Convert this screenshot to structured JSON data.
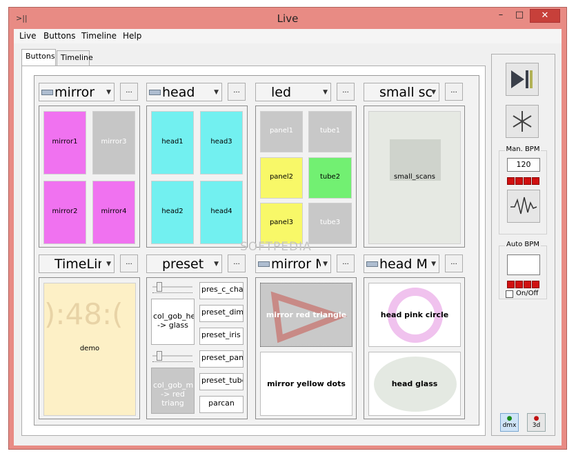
{
  "window": {
    "title": "Live",
    "app_icon": ">||",
    "minimize_glyph": "–",
    "maximize_glyph": "□",
    "close_glyph": "✕"
  },
  "menu": [
    "Live",
    "Buttons",
    "Timeline",
    "Help"
  ],
  "tabs": [
    "Buttons",
    "Timeline"
  ],
  "groups": [
    {
      "title": "mirror",
      "has_indicator": true,
      "more": "...",
      "cells": [
        {
          "label": "mirror1",
          "color": "#f072f0",
          "dim": false
        },
        {
          "label": "mirror3",
          "color": "#c6c6c6",
          "dim": true
        },
        {
          "label": "mirror2",
          "color": "#f072f0",
          "dim": false
        },
        {
          "label": "mirror4",
          "color": "#f072f0",
          "dim": false
        }
      ]
    },
    {
      "title": "head",
      "has_indicator": true,
      "more": "...",
      "cells": [
        {
          "label": "head1",
          "color": "#72f0f0",
          "dim": false
        },
        {
          "label": "head3",
          "color": "#72f0f0",
          "dim": false
        },
        {
          "label": "head2",
          "color": "#72f0f0",
          "dim": false
        },
        {
          "label": "head4",
          "color": "#72f0f0",
          "dim": false
        }
      ]
    },
    {
      "title": "led",
      "has_indicator": false,
      "more": "...",
      "cells": [
        {
          "label": "panel1",
          "color": "#c8c8c8",
          "dim": true
        },
        {
          "label": "tube1",
          "color": "#c8c8c8",
          "dim": true
        },
        {
          "label": "panel2",
          "color": "#f8f868",
          "dim": false
        },
        {
          "label": "tube2",
          "color": "#72f072",
          "dim": false
        },
        {
          "label": "panel3",
          "color": "#f8f868",
          "dim": false
        },
        {
          "label": "tube3",
          "color": "#c8c8c8",
          "dim": true
        }
      ]
    },
    {
      "title": "small sc",
      "has_indicator": false,
      "more": "...",
      "cells": [
        {
          "label": "small_scans",
          "color": "#e6e9e3",
          "dim": false
        }
      ]
    },
    {
      "title": "TimeLin",
      "has_indicator": false,
      "more": "...",
      "cells": [
        {
          "label": "demo",
          "color": "#fdf0c6",
          "dim": false
        }
      ],
      "digits": "):48:("
    },
    {
      "title": "preset",
      "has_indicator": false,
      "more": "...",
      "left_buttons": [
        "col_gob_hea -> glass",
        "col_gob_mirr -> red triang"
      ],
      "right_buttons": [
        "pres_c_cha",
        "preset_dimm",
        "preset_iris",
        "preset_pane",
        "preset_tube",
        "parcan"
      ]
    },
    {
      "title": "mirror M",
      "has_indicator": true,
      "more": "...",
      "cells": [
        {
          "label": "mirror red triangle",
          "color": "#c9c9c9",
          "dim": true
        },
        {
          "label": "mirror yellow dots",
          "color": "#ffffff",
          "dim": false
        }
      ]
    },
    {
      "title": "head M",
      "has_indicator": true,
      "more": "...",
      "cells": [
        {
          "label": "head pink circle",
          "color": "#ffffff",
          "dim": false
        },
        {
          "label": "head glass",
          "color": "#ffffff",
          "dim": false
        }
      ]
    }
  ],
  "side": {
    "man_bpm_label": "Man. BPM",
    "man_bpm_value": "120",
    "auto_bpm_label": "Auto BPM",
    "auto_bpm_value": "",
    "onoff_label": "On/Off",
    "dmx_label": "dmx",
    "three_d_label": "3d"
  },
  "watermark": "SOFTPEDIA"
}
